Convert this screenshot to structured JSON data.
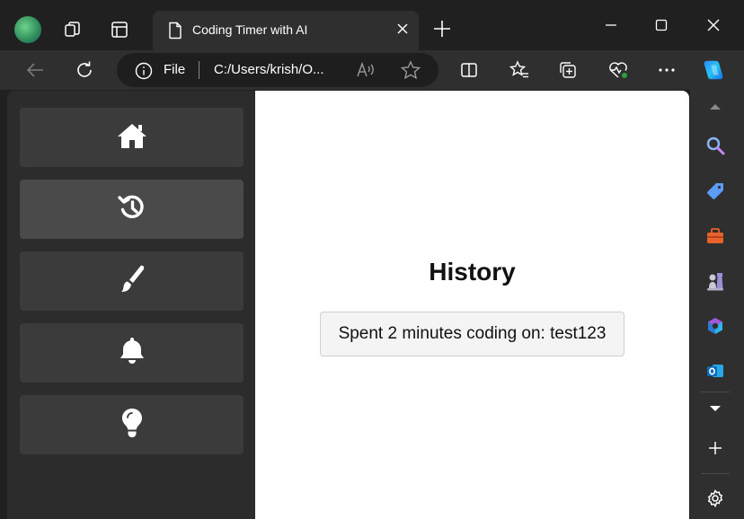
{
  "browser": {
    "tab": {
      "title": "Coding Timer with AI"
    },
    "address": {
      "scheme_label": "File",
      "url": "C:/Users/krish/O..."
    }
  },
  "app": {
    "nav": {
      "items": [
        {
          "icon": "home-icon",
          "active": false
        },
        {
          "icon": "history-icon",
          "active": true
        },
        {
          "icon": "paintbrush-icon",
          "active": false
        },
        {
          "icon": "bell-icon",
          "active": false
        },
        {
          "icon": "lightbulb-icon",
          "active": false
        }
      ]
    },
    "history": {
      "title": "History",
      "entries": [
        {
          "text": "Spent 2 minutes coding on: test123"
        }
      ]
    }
  },
  "colors": {
    "chrome_dark": "#202020",
    "chrome_toolbar": "#2f2f2f",
    "nav_panel": "#2c2c2c",
    "nav_item": "#3b3b3b",
    "nav_item_active": "#4a4a4a",
    "content_bg": "#ffffff"
  }
}
